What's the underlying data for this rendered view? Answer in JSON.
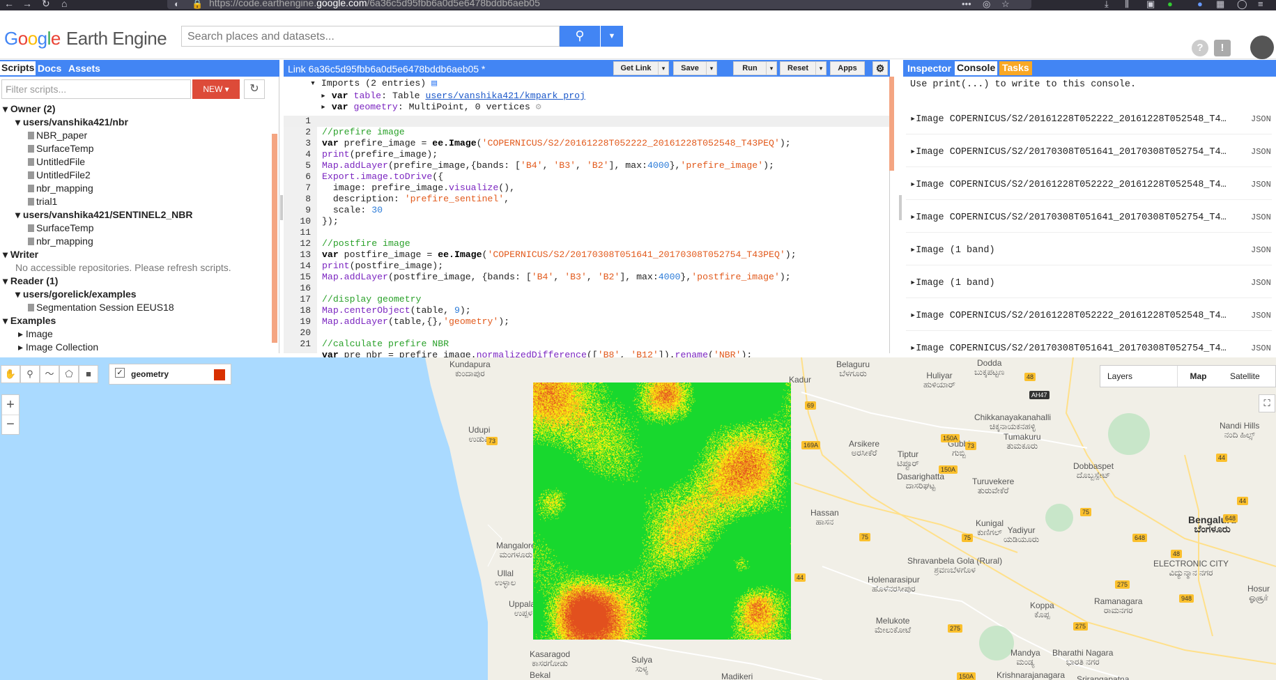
{
  "browser": {
    "url_prefix": "https://code.earthengine.",
    "url_domain": "google.com",
    "url_path": "/6a36c5d95fbb6a0d5e6478bddb6aeb05"
  },
  "header": {
    "logo_earth_engine": "Earth Engine",
    "search_placeholder": "Search places and datasets..."
  },
  "left_panel": {
    "tabs": [
      "Scripts",
      "Docs",
      "Assets"
    ],
    "filter_placeholder": "Filter scripts...",
    "new_label": "NEW",
    "tree": {
      "owner": "Owner  (2)",
      "repo1": "users/vanshika421/nbr",
      "repo1_files": [
        "NBR_paper",
        "SurfaceTemp",
        "UntitledFile",
        "UntitledFile2",
        "nbr_mapping",
        "trial1"
      ],
      "repo2": "users/vanshika421/SENTINEL2_NBR",
      "repo2_files": [
        "SurfaceTemp",
        "nbr_mapping"
      ],
      "writer": "Writer",
      "writer_note": "No accessible repositories. Please refresh scripts.",
      "reader": "Reader  (1)",
      "repo3": "users/gorelick/examples",
      "repo3_files": [
        "Segmentation Session EEUS18"
      ],
      "examples": "Examples",
      "examples_items": [
        "Image",
        "Image Collection"
      ]
    }
  },
  "editor": {
    "title": "Link 6a36c5d95fbb6a0d5e6478bddb6aeb05 *",
    "buttons": [
      "Get Link",
      "Save",
      "Run",
      "Reset",
      "Apps"
    ],
    "imports_header": "Imports (2 entries)",
    "import1_var": "var",
    "import1_name": "table",
    "import1_type": "Table",
    "import1_link": "users/vanshika421/kmpark_proj",
    "import2_var": "var",
    "import2_name": "geometry",
    "import2_type": "MultiPoint, 0 vertices",
    "line_numbers": [
      "1",
      "2",
      "3",
      "4",
      "5",
      "6",
      "7",
      "8",
      "9",
      "10",
      "11",
      "12",
      "13",
      "14",
      "15",
      "16",
      "17",
      "18",
      "19",
      "20",
      "21"
    ]
  },
  "console": {
    "tabs": [
      "Inspector",
      "Console",
      "Tasks"
    ],
    "hint": "Use print(...) to write to this console.",
    "rows": [
      "Image COPERNICUS/S2/20161228T052222_20161228T052548_T4…",
      "Image COPERNICUS/S2/20170308T051641_20170308T052754_T4…",
      "Image COPERNICUS/S2/20161228T052222_20161228T052548_T4…",
      "Image COPERNICUS/S2/20170308T051641_20170308T052754_T4…",
      "Image (1 band)",
      "Image (1 band)",
      "Image COPERNICUS/S2/20161228T052222_20161228T052548_T4…",
      "Image COPERNICUS/S2/20170308T051641_20170308T052754_T4…"
    ],
    "json_label": "JSON"
  },
  "map": {
    "layer_label": "geometry",
    "layers_label": "Layers",
    "map_label": "Map",
    "satellite_label": "Satellite",
    "zoom_in": "+",
    "zoom_out": "−",
    "cities": [
      {
        "name": "Kundapura",
        "local": "ಕುಂದಾಪುರ"
      },
      {
        "name": "Udupi",
        "local": "ಉಡುಪಿ"
      },
      {
        "name": "Mangalore",
        "local": "ಮಂಗಳೂರು"
      },
      {
        "name": "Ullal",
        "local": "ಉಳ್ಳಾಲ"
      },
      {
        "name": "Uppala Gate",
        "local": "ಉಪ್ಪಳ ಗೇಟ್"
      },
      {
        "name": "Kasaragod",
        "local": "ಕಾಸರಗೋಡು"
      },
      {
        "name": "Belaguru",
        "local": "ಬೆಳಗೂರು"
      },
      {
        "name": "Huliyar",
        "local": "ಹುಳಿಯಾರ್"
      },
      {
        "name": "Chikkanayakanahalli",
        "local": "ಚಿಕ್ಕನಾಯಕನಹಳ್ಳಿ"
      },
      {
        "name": "Arsikere",
        "local": "ಅರಸೀಕೆರೆ"
      },
      {
        "name": "Tiptur",
        "local": "ಟಿಪ್ಟೂರ್"
      },
      {
        "name": "Gubbi",
        "local": "ಗುಬ್ಬಿ"
      },
      {
        "name": "Tumakuru",
        "local": "ತುಮಕೂರು"
      },
      {
        "name": "Nandi Hills",
        "local": "ನಂದಿ ಹಿಲ್ಸ್"
      },
      {
        "name": "Dasarighatta",
        "local": "ದಾಸರಿಘಟ್ಟ"
      },
      {
        "name": "Turuvekere",
        "local": "ತುರುವೇಕೆರೆ"
      },
      {
        "name": "Dobbaspet",
        "local": "ದೊಬ್ಬಸ್ಪೇಟ್"
      },
      {
        "name": "Hassan",
        "local": "ಹಾಸನ"
      },
      {
        "name": "Kunigal",
        "local": "ಕುಣಿಗಲ್"
      },
      {
        "name": "Yadiyur",
        "local": "ಯಡಿಯೂರು"
      },
      {
        "name": "Bengaluru",
        "local": "ಬೆಂಗಳೂರು"
      },
      {
        "name": "Shravanbela Gola (Rural)",
        "local": "ಶ್ರವಣಬೆಳಗೊಳ"
      },
      {
        "name": "Holenarasipur",
        "local": "ಹೊಳೆನರಸೀಪುರ"
      },
      {
        "name": "ELECTRONIC CITY",
        "local": "ವಿದ್ಯುನ್ಮಾನ ನಗರ"
      },
      {
        "name": "Koppa",
        "local": "ಕೊಪ್ಪ"
      },
      {
        "name": "Ramanagara",
        "local": "ರಾಮನಗರ"
      },
      {
        "name": "Hosur",
        "local": "ஓசூர்"
      },
      {
        "name": "Melukote",
        "local": "ಮೇಲುಕೋಟೆ"
      },
      {
        "name": "Mandya",
        "local": "ಮಂಡ್ಯ"
      },
      {
        "name": "Bharathi Nagara",
        "local": "ಭಾರತಿ ನಗರ"
      },
      {
        "name": "Madikeri",
        "local": ""
      },
      {
        "name": "Krishnarajanagara",
        "local": ""
      },
      {
        "name": "Srirangapatna",
        "local": ""
      },
      {
        "name": "Dodda",
        "local": "ಬುಕ್ಕಪಟ್ಟಣ"
      },
      {
        "name": "Kadur",
        "local": ""
      },
      {
        "name": "Sulya",
        "local": "ಸುಳ್ಯ"
      },
      {
        "name": "Bekal",
        "local": ""
      }
    ],
    "roads": [
      "48",
      "AH47",
      "69",
      "73",
      "169A",
      "150A",
      "73",
      "150A",
      "44",
      "648",
      "44",
      "75",
      "648",
      "75",
      "75",
      "48",
      "275",
      "948",
      "275",
      "150A",
      "275",
      "44"
    ]
  },
  "colors": {
    "brand_blue": "#4285f4",
    "new_red": "#dd4b39",
    "tasks_orange": "#f9a825",
    "raster_green": "#18d82e",
    "raster_yellow": "#f6f20c",
    "raster_orange": "#f49b23"
  }
}
